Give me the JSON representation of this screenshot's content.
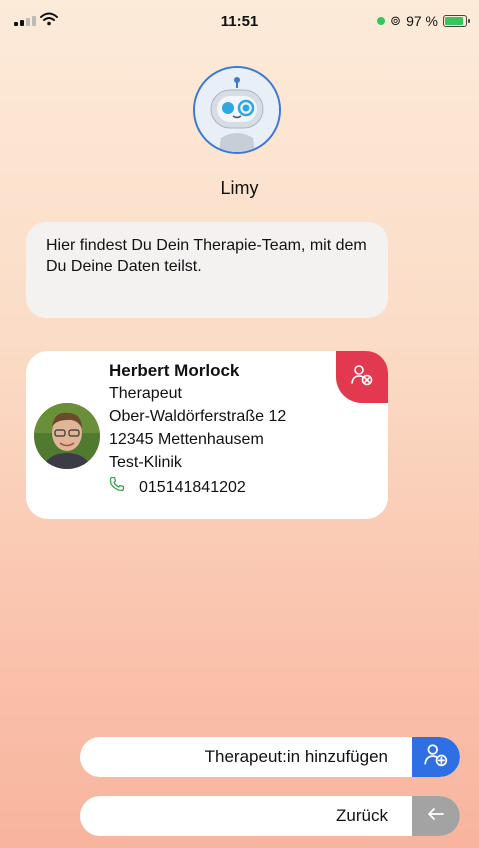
{
  "status_bar": {
    "time": "11:51",
    "battery_percent": "97 %",
    "battery_level": 0.97,
    "signal_bars": 2
  },
  "assistant": {
    "name": "Limy",
    "message": "Hier findest Du Dein Therapie-Team, mit dem Du Deine Daten teilst."
  },
  "therapist": {
    "name": "Herbert Morlock",
    "role": "Therapeut",
    "street": "Ober-Waldörferstraße 12",
    "city": "12345 Mettenhausem",
    "clinic": "Test-Klinik",
    "phone": "015141841202"
  },
  "actions": {
    "add_label": "Therapeut:in hinzufügen",
    "back_label": "Zurück"
  },
  "colors": {
    "accent_blue": "#2f6fe4",
    "remove_red": "#e23951",
    "phone_green": "#35a852",
    "back_gray": "#a3a3a3"
  },
  "icons": {
    "remove": "user-remove-icon",
    "add": "user-add-icon",
    "back": "arrow-left-icon",
    "phone": "phone-icon"
  }
}
